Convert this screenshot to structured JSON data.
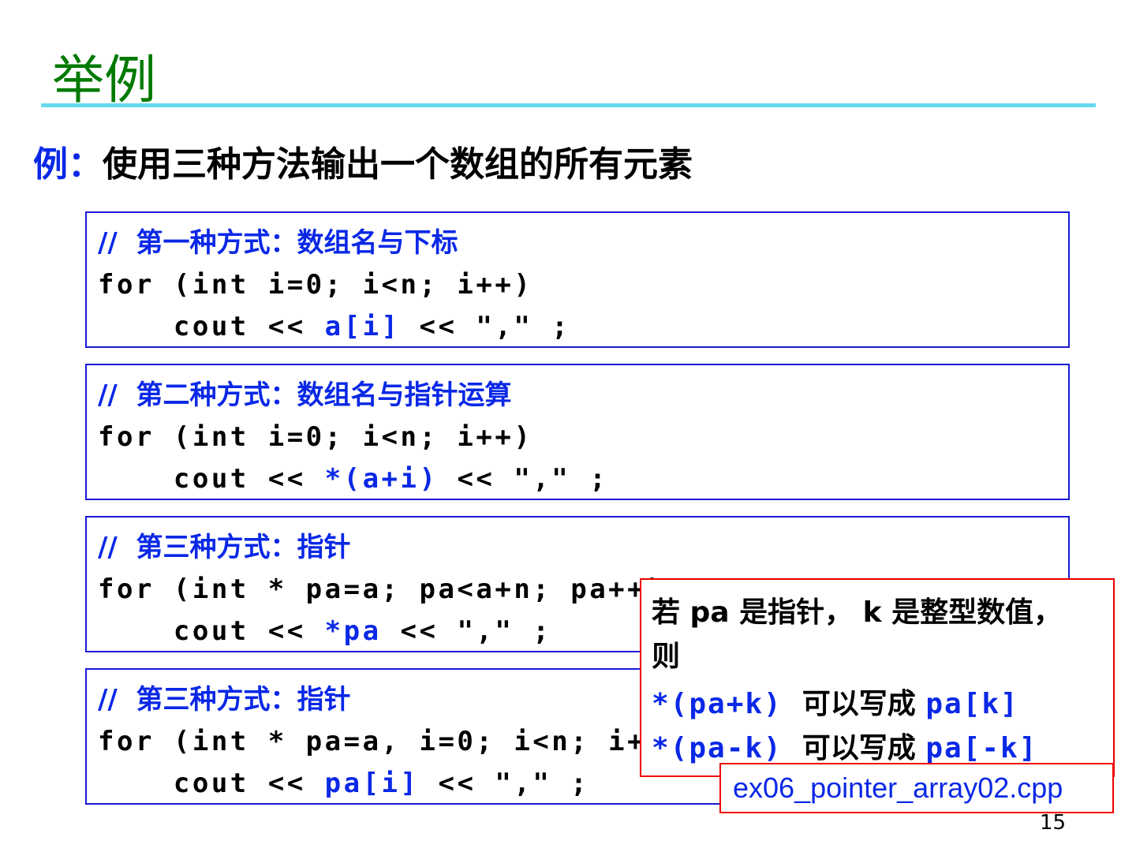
{
  "title": "举例",
  "subtitle": {
    "label": "例：",
    "text": "使用三种方法输出一个数组的所有元素"
  },
  "blocks": [
    {
      "comment": "//  第一种方式：数组名与下标",
      "loop": "for (int i=0; i<n; i++)",
      "cout_pre": "    cout << ",
      "expr": "a[i]",
      "cout_post": " << \",\" ;"
    },
    {
      "comment": "//  第二种方式：数组名与指针运算",
      "loop": "for (int i=0; i<n; i++)",
      "cout_pre": "    cout << ",
      "expr": "*(a+i)",
      "cout_post": " << \",\" ;"
    },
    {
      "comment": "//  第三种方式：指针",
      "loop": "for (int * pa=a; pa<a+n; pa++)",
      "cout_pre": "    cout << ",
      "expr": "*pa",
      "cout_post": " << \",\" ;"
    },
    {
      "comment": "//  第三种方式：指针",
      "loop": "for (int * pa=a, i=0; i<n; i++)",
      "cout_pre": "    cout << ",
      "expr": "pa[i]",
      "cout_post": " << \",\" ;"
    }
  ],
  "note": {
    "line1": "若 pa 是指针， k 是整型数值，",
    "line2": "则",
    "rows": [
      {
        "a": "*(pa+k)",
        "mid": "  可以写成 ",
        "b": "pa[k]"
      },
      {
        "a": "*(pa-k)",
        "mid": "  可以写成 ",
        "b": "pa[-k]"
      }
    ]
  },
  "filename": "ex06_pointer_array02.cpp",
  "page_number": "15"
}
